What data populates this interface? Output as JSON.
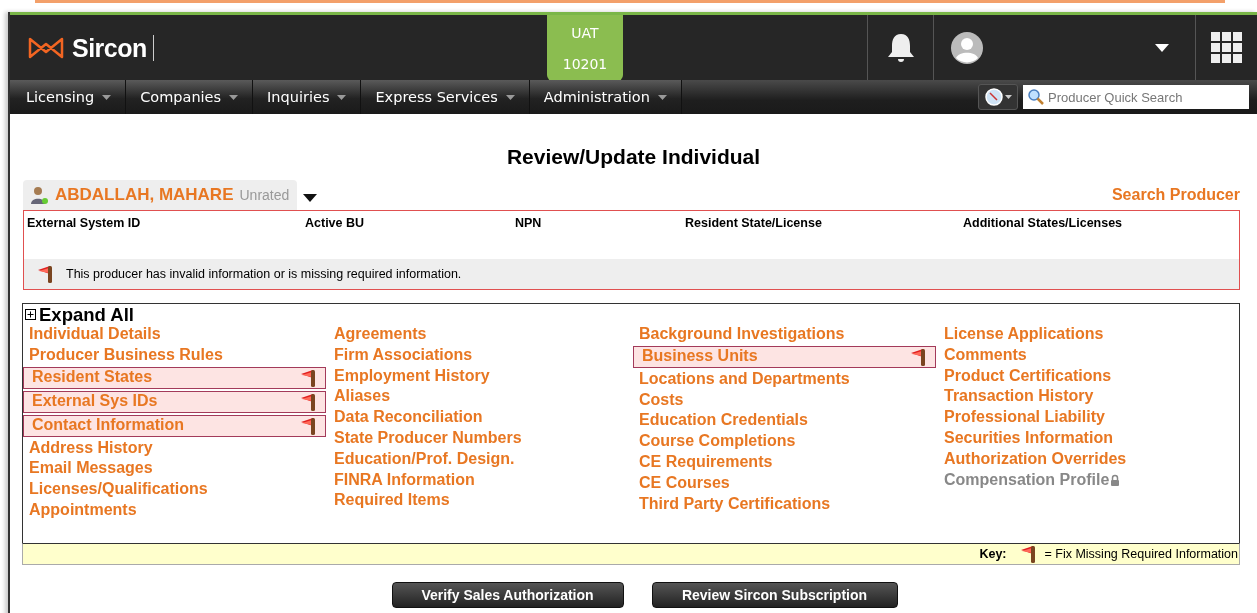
{
  "header": {
    "logo": "Sircon",
    "environment": {
      "name": "UAT",
      "code": "10201"
    }
  },
  "nav": {
    "menus": [
      "Licensing",
      "Companies",
      "Inquiries",
      "Express Services",
      "Administration"
    ],
    "search": {
      "placeholder": "Producer Quick Search"
    }
  },
  "title": "Review/Update Individual",
  "producer": {
    "name": "ABDALLAH, MAHARE",
    "rating": "Unrated"
  },
  "search_link": "Search Producer",
  "summary": {
    "columns": [
      "External System ID",
      "Active BU",
      "NPN",
      "Resident State/License",
      "Additional States/Licenses"
    ],
    "message": "This producer has invalid information or is missing required information."
  },
  "sections": {
    "expand_label": "Expand All",
    "columns": [
      [
        {
          "label": "Individual Details",
          "flagged": false,
          "disabled": false
        },
        {
          "label": "Producer Business Rules",
          "flagged": false,
          "disabled": false
        },
        {
          "label": "Resident States",
          "flagged": true,
          "disabled": false
        },
        {
          "label": "External Sys IDs",
          "flagged": true,
          "disabled": false
        },
        {
          "label": "Contact Information",
          "flagged": true,
          "disabled": false
        },
        {
          "label": "Address History",
          "flagged": false,
          "disabled": false
        },
        {
          "label": "Email Messages",
          "flagged": false,
          "disabled": false
        },
        {
          "label": "Licenses/Qualifications",
          "flagged": false,
          "disabled": false
        },
        {
          "label": "Appointments",
          "flagged": false,
          "disabled": false
        }
      ],
      [
        {
          "label": "Agreements",
          "flagged": false,
          "disabled": false
        },
        {
          "label": "Firm Associations",
          "flagged": false,
          "disabled": false
        },
        {
          "label": "Employment History",
          "flagged": false,
          "disabled": false
        },
        {
          "label": "Aliases",
          "flagged": false,
          "disabled": false
        },
        {
          "label": "Data Reconciliation",
          "flagged": false,
          "disabled": false
        },
        {
          "label": "State Producer Numbers",
          "flagged": false,
          "disabled": false
        },
        {
          "label": "Education/Prof. Design.",
          "flagged": false,
          "disabled": false
        },
        {
          "label": "FINRA Information",
          "flagged": false,
          "disabled": false
        },
        {
          "label": "Required Items",
          "flagged": false,
          "disabled": false
        }
      ],
      [
        {
          "label": "Background Investigations",
          "flagged": false,
          "disabled": false
        },
        {
          "label": "Business Units",
          "flagged": true,
          "disabled": false
        },
        {
          "label": "Locations and Departments",
          "flagged": false,
          "disabled": false
        },
        {
          "label": "Costs",
          "flagged": false,
          "disabled": false
        },
        {
          "label": "Education Credentials",
          "flagged": false,
          "disabled": false
        },
        {
          "label": "Course Completions",
          "flagged": false,
          "disabled": false
        },
        {
          "label": "CE Requirements",
          "flagged": false,
          "disabled": false
        },
        {
          "label": "CE Courses",
          "flagged": false,
          "disabled": false
        },
        {
          "label": "Third Party Certifications",
          "flagged": false,
          "disabled": false
        }
      ],
      [
        {
          "label": "License Applications",
          "flagged": false,
          "disabled": false
        },
        {
          "label": "Comments",
          "flagged": false,
          "disabled": false
        },
        {
          "label": "Product Certifications",
          "flagged": false,
          "disabled": false
        },
        {
          "label": "Transaction History",
          "flagged": false,
          "disabled": false
        },
        {
          "label": "Professional Liability",
          "flagged": false,
          "disabled": false
        },
        {
          "label": "Securities Information",
          "flagged": false,
          "disabled": false
        },
        {
          "label": "Authorization Overrides",
          "flagged": false,
          "disabled": false
        },
        {
          "label": "Compensation Profile",
          "flagged": false,
          "disabled": true
        }
      ]
    ]
  },
  "key": {
    "label": "Key:",
    "text": "= Fix Missing Required Information"
  },
  "buttons": [
    "Verify Sales Authorization",
    "Review Sircon Subscription"
  ]
}
